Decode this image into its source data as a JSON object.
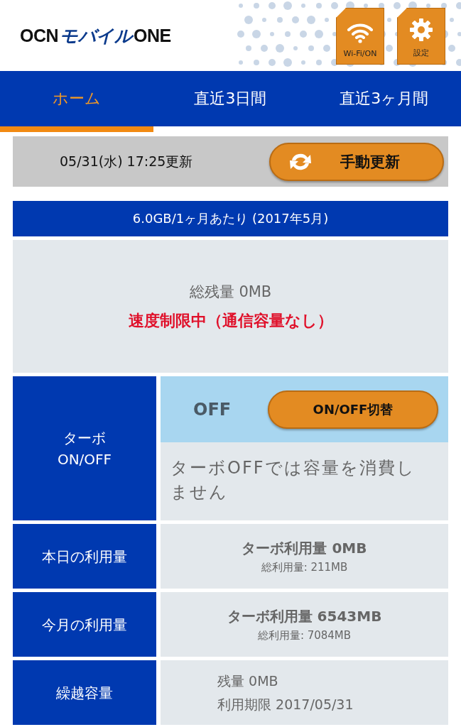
{
  "header": {
    "logo": [
      {
        "text": "OCN",
        "accent": false
      },
      {
        "text": "モバイル",
        "accent": true
      },
      {
        "text": "ONE",
        "accent": false
      }
    ],
    "buttons": [
      {
        "kind": "wifi",
        "label": "Wi-Fi/ON"
      },
      {
        "kind": "settings",
        "label": "設定"
      }
    ]
  },
  "tabs": [
    {
      "label": "ホーム",
      "selected": true
    },
    {
      "label": "直近3日間",
      "selected": false
    },
    {
      "label": "直近3ヶ月間",
      "selected": false
    }
  ],
  "update": {
    "timestamp": "05/31(水) 17:25更新",
    "button": "手動更新"
  },
  "plan": {
    "title": "6.0GB/1ヶ月あたり (2017年5月)",
    "remaining": "総残量 0MB",
    "warning": "速度制限中（通信容量なし）"
  },
  "turbo": {
    "label": [
      "ターボ",
      "ON/OFF"
    ],
    "status": "OFF",
    "button": "ON/OFF切替",
    "note": "ターボOFFでは容量を消費しません"
  },
  "rows": [
    {
      "kind": "usage",
      "label": "本日の利用量",
      "turbo": "ターボ利用量 0MB",
      "total": "総利用量: 211MB"
    },
    {
      "kind": "usage",
      "label": "今月の利用量",
      "turbo": "ターボ利用量 6543MB",
      "total": "総利用量: 7084MB"
    },
    {
      "kind": "carryover",
      "label": "繰越容量",
      "lines": [
        "残量 0MB",
        "利用期限 2017/05/31"
      ]
    }
  ]
}
